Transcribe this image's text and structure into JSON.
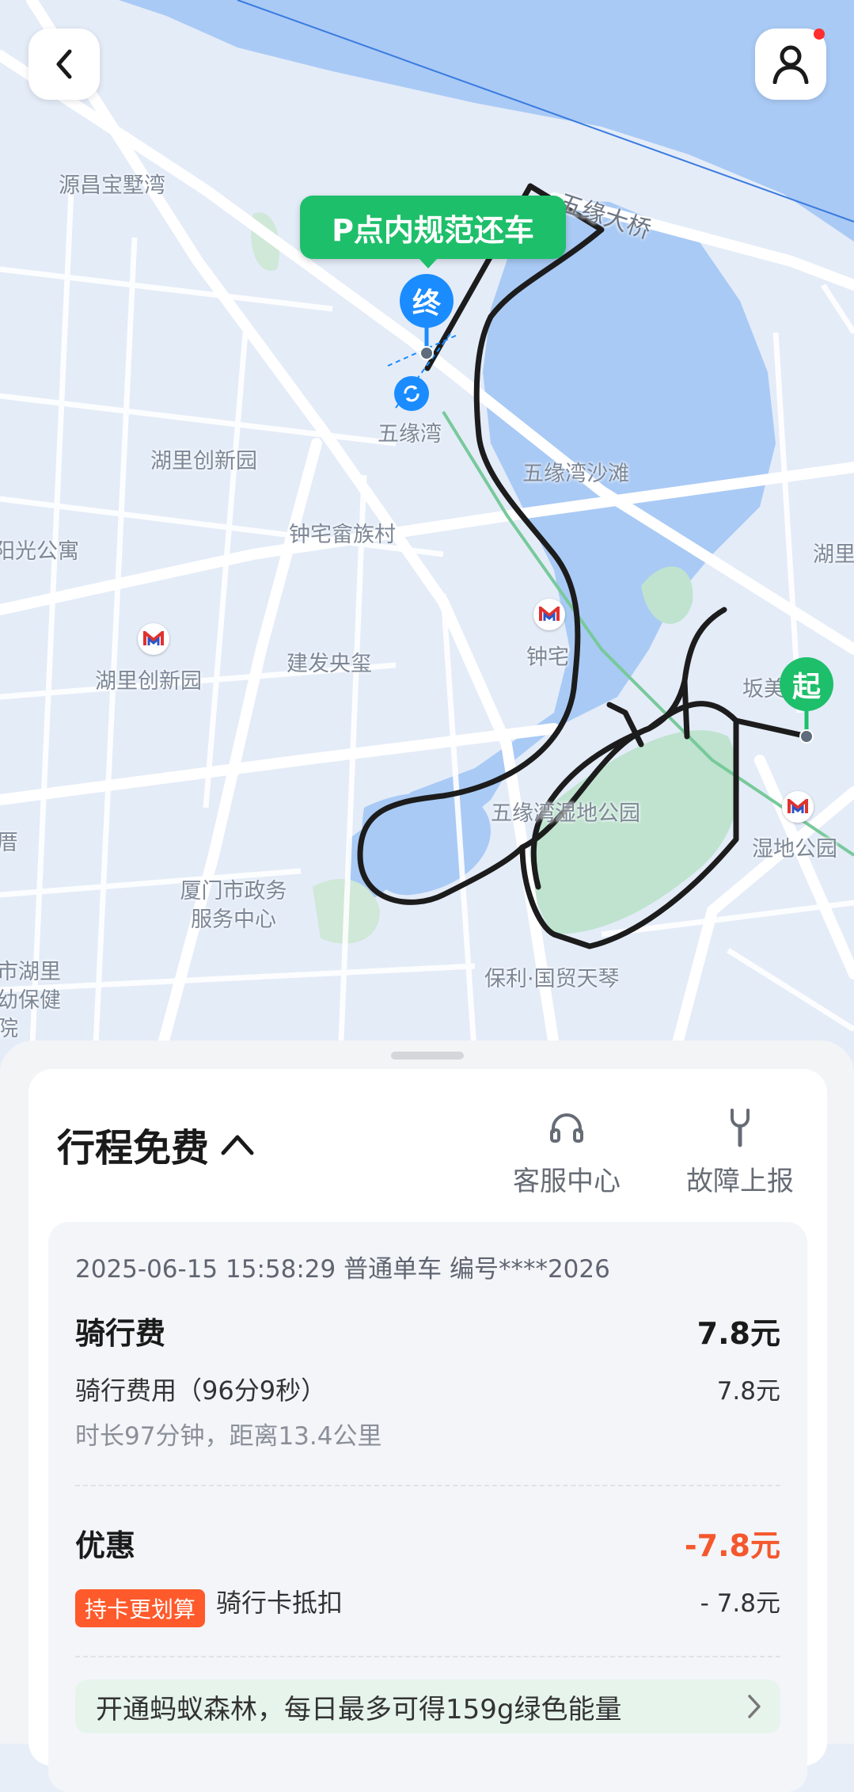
{
  "map": {
    "labels": [
      {
        "id": "yuanchang",
        "text": "源昌宝墅湾"
      },
      {
        "id": "wuyuan-bridge",
        "text": "五缘大桥"
      },
      {
        "id": "wuyuanwan",
        "text": "五缘湾"
      },
      {
        "id": "huli-innovation",
        "text": "湖里创新园"
      },
      {
        "id": "beach",
        "text": "五缘湾沙滩"
      },
      {
        "id": "zhongzhai-she",
        "text": "钟宅畲族村"
      },
      {
        "id": "sunlight",
        "text": "阳光公寓"
      },
      {
        "id": "hu-east",
        "text": "湖里"
      },
      {
        "id": "zhongzhai-station",
        "text": "钟宅"
      },
      {
        "id": "huli-innovation-station",
        "text": "湖里创新园"
      },
      {
        "id": "jianfa",
        "text": "建发央玺"
      },
      {
        "id": "banmei",
        "text": "坂美"
      },
      {
        "id": "wetland-park",
        "text": "五缘湾湿地公园"
      },
      {
        "id": "wetland-station",
        "text": "湿地公园"
      },
      {
        "id": "left-edge",
        "text": "厝"
      },
      {
        "id": "gov-center",
        "text": "厦门市政务服务中心"
      },
      {
        "id": "huli-health",
        "text": "市湖里幼保健院"
      },
      {
        "id": "baoli",
        "text": "保利·国贸天琴"
      }
    ],
    "return_tag": "P点内规范还车",
    "end_pin": "终",
    "start_pin": "起"
  },
  "colors": {
    "map_land": "#e4ecf8",
    "map_water": "#a9caf5",
    "road": "#ffffff",
    "route": "#1c1c1c",
    "accent_green": "#1ebf6a",
    "end_blue": "#1a8cff",
    "discount_red": "#f5572d",
    "metro_red": "#e0322f",
    "metro_blue": "#2a56c6"
  },
  "icons": {
    "back": "chevron-left-icon",
    "profile": "user-icon",
    "customer_service": "headset-icon",
    "fault_report": "wrench-icon",
    "metro": "metro-icon",
    "bike_station": "bike-station-icon"
  },
  "sheet": {
    "title": "行程免费",
    "actions": [
      {
        "id": "service",
        "label": "客服中心"
      },
      {
        "id": "fault",
        "label": "故障上报"
      }
    ],
    "meta": "2025-06-15 15:58:29 普通单车 编号****2026",
    "ride_fee": {
      "title": "骑行费",
      "amount": "7.8元",
      "item_label": "骑行费用（96分9秒）",
      "item_amount": "7.8元",
      "summary": "时长97分钟，距离13.4公里"
    },
    "discount": {
      "title": "优惠",
      "amount": "-7.8元",
      "badge": "持卡更划算",
      "item_label": "骑行卡抵扣",
      "item_amount": "- 7.8元"
    },
    "promo": "开通蚂蚁森林，每日最多可得159g绿色能量"
  }
}
